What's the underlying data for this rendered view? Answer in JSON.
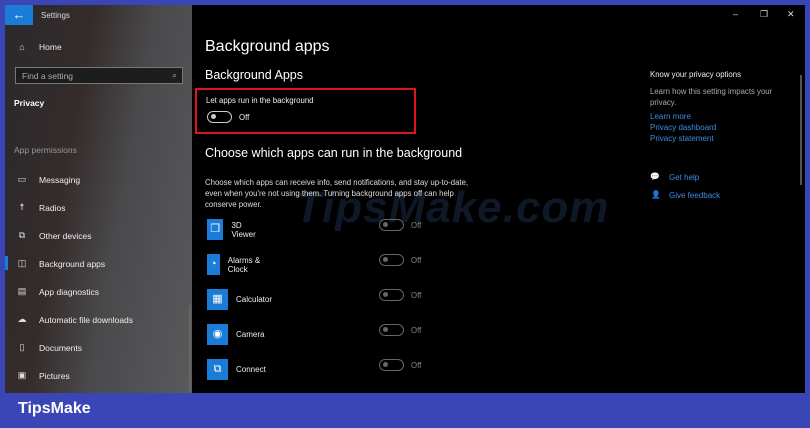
{
  "window": {
    "title": "Settings",
    "minimize": "–",
    "restore": "❐",
    "close": "✕"
  },
  "sidebar": {
    "home": "Home",
    "search_placeholder": "Find a setting",
    "section": "Privacy",
    "group": "App permissions",
    "items": [
      {
        "label": "Messaging",
        "icon": "▭"
      },
      {
        "label": "Radios",
        "icon": "☨"
      },
      {
        "label": "Other devices",
        "icon": "⧉"
      },
      {
        "label": "Background apps",
        "icon": "◫"
      },
      {
        "label": "App diagnostics",
        "icon": "▤"
      },
      {
        "label": "Automatic file downloads",
        "icon": "☁"
      },
      {
        "label": "Documents",
        "icon": "▯"
      },
      {
        "label": "Pictures",
        "icon": "▣"
      }
    ]
  },
  "main": {
    "title": "Background apps",
    "subtitle": "Background Apps",
    "toggle_label": "Let apps run in the background",
    "toggle_state": "Off",
    "choose_heading": "Choose which apps can run in the background",
    "choose_desc": "Choose which apps can receive info, send notifications, and stay up-to-date, even when you're not using them. Turning background apps off can help conserve power.",
    "apps": [
      {
        "name": "3D Viewer",
        "state": "Off",
        "icon": "❒"
      },
      {
        "name": "Alarms & Clock",
        "state": "Off",
        "icon": "◔"
      },
      {
        "name": "Calculator",
        "state": "Off",
        "icon": "▦"
      },
      {
        "name": "Camera",
        "state": "Off",
        "icon": "◉"
      },
      {
        "name": "Connect",
        "state": "Off",
        "icon": "⧉"
      }
    ]
  },
  "right": {
    "heading": "Know your privacy options",
    "text": "Learn how this setting impacts your privacy.",
    "learn_more": "Learn more",
    "dashboard": "Privacy dashboard",
    "statement": "Privacy statement",
    "help": "Get help",
    "feedback": "Give feedback"
  },
  "watermark": "TipsMake.com",
  "brand": "TipsMake"
}
